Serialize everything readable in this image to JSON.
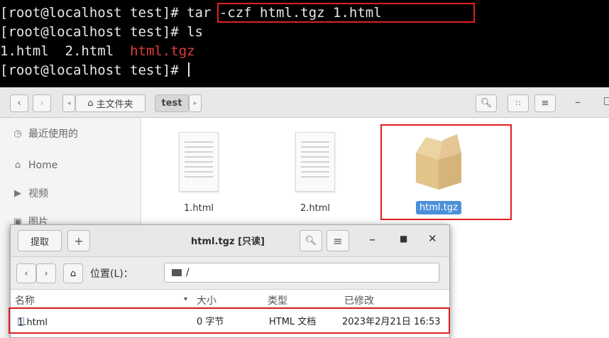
{
  "terminal": {
    "line1_prompt": "[root@localhost test]# ",
    "line1_cmd": "tar -czf html.tgz 1.html",
    "line2": "[root@localhost test]# ls",
    "line3_files": [
      "1.html",
      "2.html"
    ],
    "line3_archive": "html.tgz",
    "line4_prompt": "[root@localhost test]# ",
    "archive_color": "#e03b3b",
    "highlight_color": "#e02020"
  },
  "file_manager": {
    "breadcrumb": {
      "home_label": "主文件夹",
      "current": "test"
    },
    "sidebar": [
      {
        "icon": "clock-icon",
        "label": "最近使用的"
      },
      {
        "icon": "home-icon",
        "label": "Home"
      },
      {
        "icon": "video-icon",
        "label": "视频"
      },
      {
        "icon": "camera-icon",
        "label": "图片"
      }
    ],
    "files": [
      {
        "name": "1.html",
        "type": "document"
      },
      {
        "name": "2.html",
        "type": "document"
      },
      {
        "name": "html.tgz",
        "type": "archive",
        "selected": true
      }
    ],
    "accent_color": "#4a90d9"
  },
  "archive_window": {
    "extract_label": "提取",
    "add_label": "+",
    "title": "html.tgz [只读]",
    "location_label": "位置(L)：",
    "location_value": "/",
    "columns": {
      "name": "名称",
      "size": "大小",
      "type": "类型",
      "modified": "已修改"
    },
    "rows": [
      {
        "name": "1.html",
        "size": "0 字节",
        "type": "HTML 文档",
        "modified": "2023年2月21日 16:53"
      }
    ]
  }
}
